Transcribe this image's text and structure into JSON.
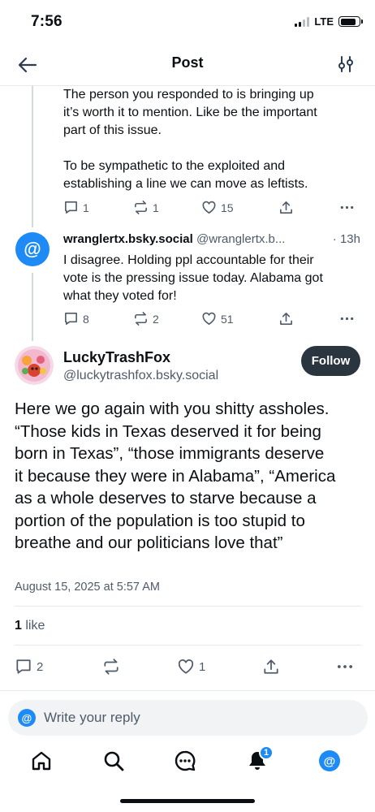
{
  "status_bar": {
    "time": "7:56",
    "network": "LTE"
  },
  "header": {
    "title": "Post",
    "back_icon": "arrow-left-icon",
    "settings_icon": "sliders-icon"
  },
  "parent_reply": {
    "lines": [
      "The person you responded to is bringing up",
      "it’s worth it to mention. Like be the important",
      "part of this issue.",
      "",
      "To be sympathetic to the exploited and",
      "establishing a line we can move as leftists."
    ],
    "replies": "1",
    "reposts": "1",
    "likes": "15"
  },
  "reply_post": {
    "display_name": "wranglertx.bsky.social",
    "handle": "@wranglertx.b...",
    "time": "· 13h",
    "lines": [
      "I disagree. Holding ppl accountable for their",
      "vote is the pressing issue today. Alabama got",
      "what they voted for!"
    ],
    "replies": "8",
    "reposts": "2",
    "likes": "51"
  },
  "main_post": {
    "display_name": "LuckyTrashFox",
    "handle": "@luckytrashfox.bsky.social",
    "follow_label": "Follow",
    "lines": [
      "Here we go again with you shitty assholes.",
      "“Those kids in Texas deserved it for being",
      "born in Texas”, “those immigrants deserve",
      "it because they were in Alabama”, “America",
      "as a whole deserves to starve because a",
      "portion of the population is too stupid to",
      "breathe and our politicians love that”"
    ],
    "date": "August 15, 2025 at 5:57 AM",
    "like_count": "1",
    "like_word": " like",
    "replies": "2",
    "reposts": "",
    "likes": "1"
  },
  "reply_box": {
    "placeholder": "Write your reply"
  },
  "tab_bar": {
    "items": [
      "home-icon",
      "search-icon",
      "chat-icon",
      "bell-icon",
      "profile-icon"
    ],
    "notification_badge": "1"
  },
  "colors": {
    "accent": "#1e8af5",
    "text": "#0b0f14",
    "muted": "#4f5b69",
    "follow_bg": "#2b3540"
  }
}
